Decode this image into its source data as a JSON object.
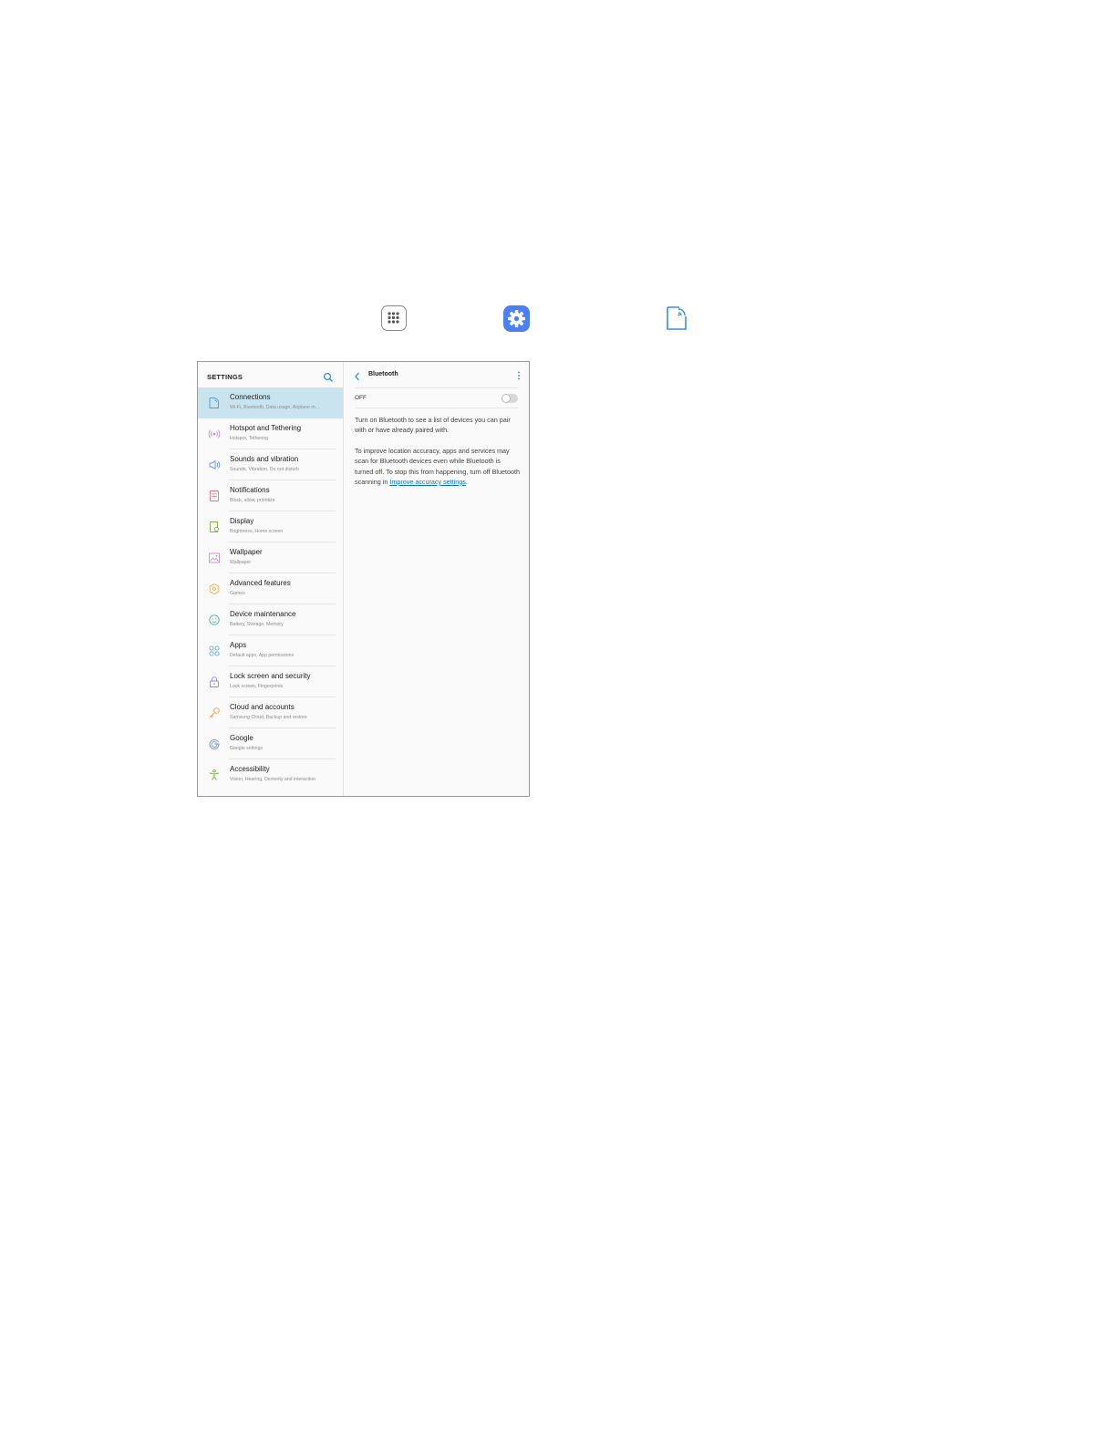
{
  "top_icons": [
    "apps-icon",
    "settings-icon",
    "connections-icon"
  ],
  "settings": {
    "title": "SETTINGS",
    "menu": [
      {
        "label": "Connections",
        "sub": "Wi-Fi, Bluetooth, Data usage, Airplane m...",
        "icon": "connections-icon",
        "color": "#5a9bd5",
        "active": true
      },
      {
        "label": "Hotspot and Tethering",
        "sub": "Hotspot, Tethering",
        "icon": "hotspot-icon",
        "color": "#b48ee0"
      },
      {
        "label": "Sounds and vibration",
        "sub": "Sounds, Vibration, Do not disturb",
        "icon": "speaker-icon",
        "color": "#6b8fd8"
      },
      {
        "label": "Notifications",
        "sub": "Block, allow, prioritize",
        "icon": "notifications-icon",
        "color": "#e57373"
      },
      {
        "label": "Display",
        "sub": "Brightness, Home screen",
        "icon": "display-icon",
        "color": "#7cb342"
      },
      {
        "label": "Wallpaper",
        "sub": "Wallpaper",
        "icon": "wallpaper-icon",
        "color": "#c58fd6"
      },
      {
        "label": "Advanced features",
        "sub": "Games",
        "icon": "advanced-features-icon",
        "color": "#f2b33d"
      },
      {
        "label": "Device maintenance",
        "sub": "Battery, Storage, Memory",
        "icon": "device-maintenance-icon",
        "color": "#4db6ac"
      },
      {
        "label": "Apps",
        "sub": "Default apps, App permissions",
        "icon": "apps-grid-icon",
        "color": "#64a8e0"
      },
      {
        "label": "Lock screen and security",
        "sub": "Lock screen, Fingerprints",
        "icon": "lock-icon",
        "color": "#8c8ce0"
      },
      {
        "label": "Cloud and accounts",
        "sub": "Samsung Cloud, Backup and restore",
        "icon": "key-icon",
        "color": "#f0a05a"
      },
      {
        "label": "Google",
        "sub": "Google settings",
        "icon": "google-icon",
        "color": "#6e8fd6"
      },
      {
        "label": "Accessibility",
        "sub": "Vision, Hearing, Dexterity and interaction",
        "icon": "accessibility-icon",
        "color": "#7cb342"
      }
    ]
  },
  "bluetooth": {
    "title": "Bluetooth",
    "state": "OFF",
    "desc1": "Turn on Bluetooth to see a list of devices you can pair with or have already paired with.",
    "desc2_prefix": "To improve location accuracy, apps and services may scan for Bluetooth devices even while Bluetooth is turned off. To stop this from happening, turn off Bluetooth scanning in ",
    "desc2_link": "Improve accuracy settings",
    "desc2_suffix": "."
  },
  "colors": {
    "accent": "#0a74c4",
    "active_row": "#c9e4ef",
    "settings_icon_bg": "#4a7ff5"
  }
}
